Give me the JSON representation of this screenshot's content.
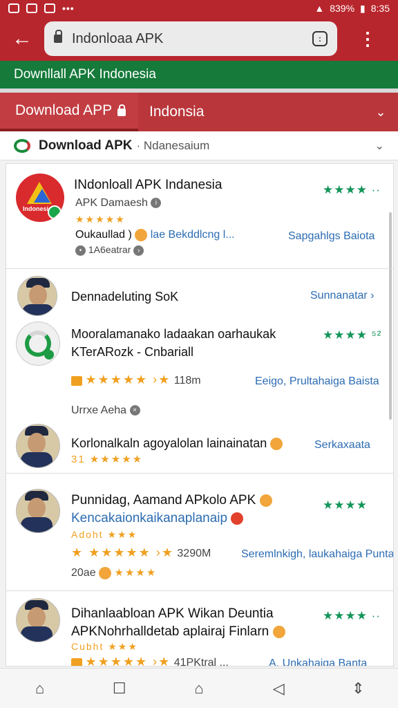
{
  "status": {
    "signal": "839%",
    "time": "8:35"
  },
  "browser": {
    "url": "Indonloaa APK",
    "tab_count": ":",
    "back": "←",
    "menu": "⋮"
  },
  "site_header": "Downllall APK Indonesia",
  "tabs": {
    "active": "Download APP",
    "region": "Indonsia"
  },
  "subheader": {
    "title": "Download APK",
    "subtitle": "· Ndanesaium"
  },
  "items": [
    {
      "title": "INdonloall APK Indanesia",
      "subtitle": "APK Damaesh",
      "stars": "★★★★ ··",
      "rating_stars": "★★★★★",
      "desc": "Oukaullad )",
      "desc2": "lae Bekddlcng l...",
      "link": "Sapgahlgs Baiota",
      "meta": "1A6eatrar"
    },
    {
      "title": "Dennadeluting SoK",
      "link": "Sunnanatar ›"
    },
    {
      "title": "Mooralamanako ladaakan oarhaukak",
      "title2": "KTerARozk - Cnbariall",
      "stars": "★★★★ ⁵²",
      "rating_stars": "★★★★★ ›★",
      "count": "118m",
      "link": "Eeigo, Prultahaiga Baista",
      "meta": "Urrxe Aeha"
    },
    {
      "title": "Korlonalkaln agoyalolan lainainatan",
      "rating": "31 ★★★★★",
      "link": "Serkaxaata"
    },
    {
      "title": "Punnidag, Aamand APkolo APK",
      "title2": "Kencakaionkaikanaplanaip",
      "tag": "Adoht ★★★",
      "stars": "★★★★",
      "rating_stars": "★ ★★★★★ ›★",
      "count": "3290M",
      "link": "Seremlnkigh, laukahaiga Punta",
      "meta": "20ae",
      "meta_stars": "★★★★"
    },
    {
      "title": "Dihanlaabloan APK Wikan Deuntia",
      "title2": "APKNohrhalldetab aplairaj Finlarn",
      "tag": "Cubht ★★★",
      "stars": "★★★★ ··",
      "rating_stars": "★★★★★ ›★",
      "count": "41PKtral ...",
      "link": "A. Unkahaiga Banta"
    }
  ],
  "nav": {
    "home": "⌂",
    "recent": "☐",
    "house": "⌂",
    "back": "◁",
    "more": "⇕"
  }
}
